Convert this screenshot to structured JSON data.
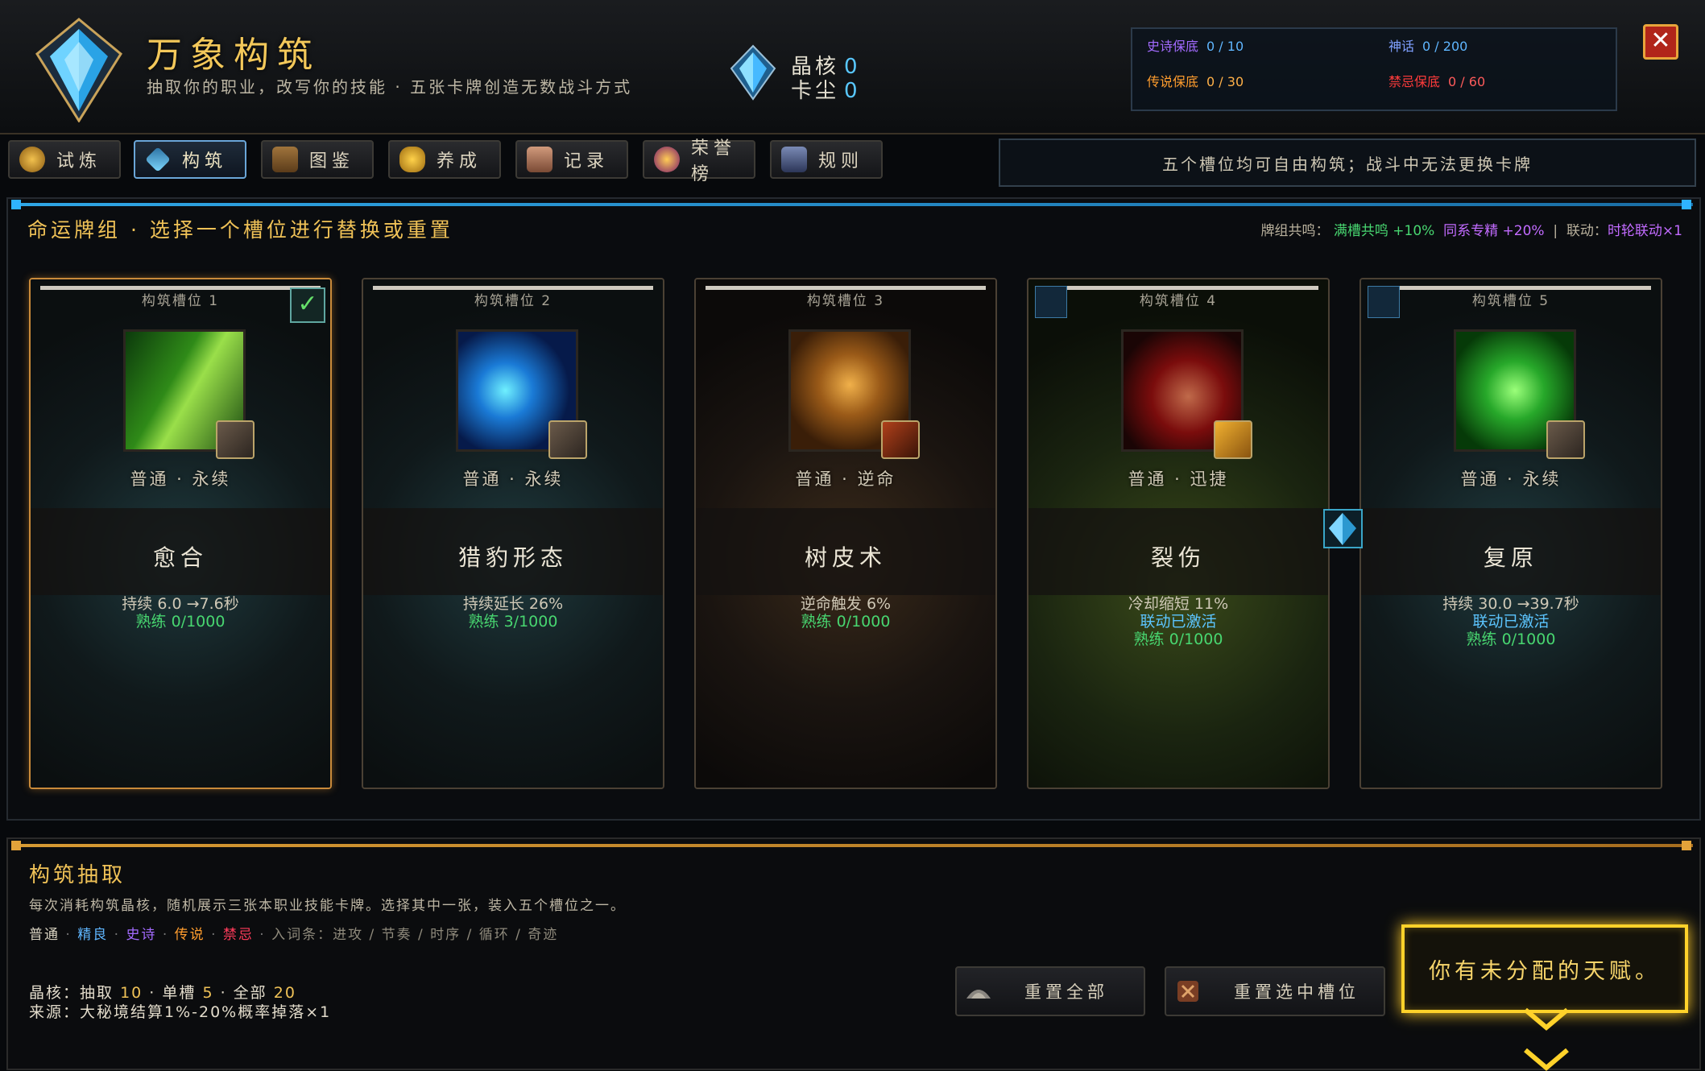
{
  "header": {
    "title": "万象构筑",
    "subtitle": "抽取你的职业，改写你的技能 · 五张卡牌创造无数战斗方式",
    "crest_icon": "crystal-crest-icon",
    "currency": [
      {
        "label": "晶核",
        "value": "0",
        "icon": "crystal-icon"
      },
      {
        "label": "卡尘",
        "value": "0"
      }
    ],
    "pity": [
      {
        "label": "史诗保底",
        "value": "0 / 10",
        "color": "#a36bff"
      },
      {
        "label": "神话",
        "value": "0 / 200",
        "color": "#7fa0ff"
      },
      {
        "label": "传说保底",
        "value": "0 / 30",
        "color": "#ff9d2e"
      },
      {
        "label": "禁忌保底",
        "value": "0 / 60",
        "color": "#ff3b3b"
      }
    ],
    "close_icon": "close-icon"
  },
  "tabs": [
    {
      "label": "试炼",
      "icon": "sun-medal-icon",
      "active": false
    },
    {
      "label": "构筑",
      "icon": "crystal-icon",
      "active": true
    },
    {
      "label": "图鉴",
      "icon": "book-icon",
      "active": false
    },
    {
      "label": "养成",
      "icon": "gear-upgrade-icon",
      "active": false
    },
    {
      "label": "记录",
      "icon": "scroll-icon",
      "active": false
    },
    {
      "label": "荣誉榜",
      "icon": "honor-seal-icon",
      "active": false
    },
    {
      "label": "规则",
      "icon": "rulebook-icon",
      "active": false
    }
  ],
  "info_banner": "五个槽位均可自由构筑；战斗中无法更换卡牌",
  "deck": {
    "title": "命运牌组 · 选择一个槽位进行替换或重置",
    "synergy": {
      "label": "牌组共鸣：",
      "full": "满槽共鸣 +10%",
      "same": "同系专精 +20%",
      "sep": "|",
      "link_label": "联动：",
      "link_value": "时轮联动×1"
    },
    "cards": [
      {
        "slot": "构筑槽位 1",
        "tags": "普通 · 永续",
        "name": "愈合",
        "stat1": "持续 6.0 →7.6秒",
        "linked": "",
        "mastery": "熟练 0/1000",
        "selected": true,
        "icon": "green-claw-heal-icon",
        "school_icon": "crossed-weapons-icon",
        "theme": "teal"
      },
      {
        "slot": "构筑槽位 2",
        "tags": "普通 · 永续",
        "name": "猎豹形态",
        "stat1": "持续延长 26%",
        "linked": "",
        "mastery": "熟练 3/1000",
        "selected": false,
        "icon": "blue-claw-icon",
        "school_icon": "crossed-weapons-icon",
        "theme": "teal"
      },
      {
        "slot": "构筑槽位 3",
        "tags": "普通 · 逆命",
        "name": "树皮术",
        "stat1": "逆命触发 6%",
        "linked": "",
        "mastery": "熟练 0/1000",
        "selected": false,
        "icon": "bark-fist-icon",
        "school_icon": "fire-rune-icon",
        "theme": "red"
      },
      {
        "slot": "构筑槽位 4",
        "tags": "普通 · 迅捷",
        "name": "裂伤",
        "stat1": "冷却缩短 11%",
        "linked": "联动已激活",
        "mastery": "熟练 0/1000",
        "selected": false,
        "icon": "feral-beast-icon",
        "school_icon": "gold-rune-icon",
        "theme": "green"
      },
      {
        "slot": "构筑槽位 5",
        "tags": "普通 · 永续",
        "name": "复原",
        "stat1": "持续 30.0 →39.7秒",
        "linked": "联动已激活",
        "mastery": "熟练 0/1000",
        "selected": false,
        "icon": "green-leaf-icon",
        "school_icon": "crossed-weapons-icon",
        "theme": "teal"
      }
    ]
  },
  "draw": {
    "title": "构筑抽取",
    "description": "每次消耗构筑晶核，随机展示三张本职业技能卡牌。选择其中一张，装入五个槽位之一。",
    "rarities": [
      {
        "label": "普通",
        "color": "#d8d2c0"
      },
      {
        "label": "精良",
        "color": "#5fb6ff"
      },
      {
        "label": "史诗",
        "color": "#a36bff"
      },
      {
        "label": "传说",
        "color": "#ff9d2e"
      },
      {
        "label": "禁忌",
        "color": "#ff3b5a"
      }
    ],
    "affixes": "入词条：进攻 / 节奏 / 时序 / 循环 / 奇迹",
    "cost": {
      "label": "晶核：",
      "draw_label": "抽取",
      "draw": "10",
      "single_label": "单槽",
      "single": "5",
      "all_label": "全部",
      "all": "20"
    },
    "source": "来源：大秘境结算1%-20%概率掉落×1",
    "reset_all": "重置全部",
    "reset_selected": "重置选中槽位",
    "talent_notice": "你有未分配的天赋。"
  }
}
